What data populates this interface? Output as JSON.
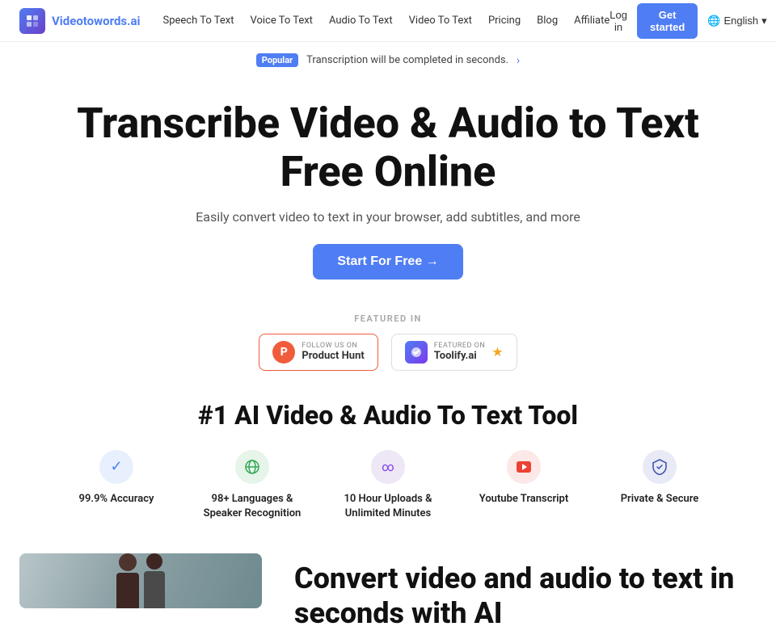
{
  "logo": {
    "text_main": "Videotowords",
    "text_accent": ".ai"
  },
  "nav": {
    "links": [
      {
        "label": "Speech To Text",
        "id": "speech-to-text"
      },
      {
        "label": "Voice To Text",
        "id": "voice-to-text"
      },
      {
        "label": "Audio To Text",
        "id": "audio-to-text"
      },
      {
        "label": "Video To Text",
        "id": "video-to-text"
      },
      {
        "label": "Pricing",
        "id": "pricing"
      },
      {
        "label": "Blog",
        "id": "blog"
      },
      {
        "label": "Affiliate",
        "id": "affiliate"
      }
    ],
    "login_label": "Log in",
    "cta_label": "Get started",
    "lang_label": "English"
  },
  "announce": {
    "badge": "Popular",
    "text": "Transcription will be completed in seconds.",
    "arrow": "›"
  },
  "hero": {
    "title": "Transcribe Video & Audio to Text Free Online",
    "subtitle": "Easily convert video to text in your browser, add subtitles, and more",
    "cta_label": "Start For Free →"
  },
  "featured": {
    "label": "FEATURED IN",
    "product_hunt": {
      "follow_label": "FOLLOW US ON",
      "name": "Product Hunt"
    },
    "toolify": {
      "featured_label": "FEATURED ON",
      "name": "Toolify.ai"
    }
  },
  "ai_section": {
    "title": "#1 AI Video & Audio To Text Tool"
  },
  "features": [
    {
      "label": "99.9% Accuracy",
      "icon": "✓",
      "icon_class": "icon-blue"
    },
    {
      "label": "98+ Languages & Speaker Recognition",
      "icon": "🌐",
      "icon_class": "icon-green"
    },
    {
      "label": "10 Hour Uploads & Unlimited Minutes",
      "icon": "∞",
      "icon_class": "icon-purple"
    },
    {
      "label": "Youtube Transcript",
      "icon": "▶",
      "icon_class": "icon-red"
    },
    {
      "label": "Private & Secure",
      "icon": "🛡",
      "icon_class": "icon-dark-blue"
    }
  ],
  "bottom": {
    "title": "Convert video and audio to text in seconds with AI"
  }
}
